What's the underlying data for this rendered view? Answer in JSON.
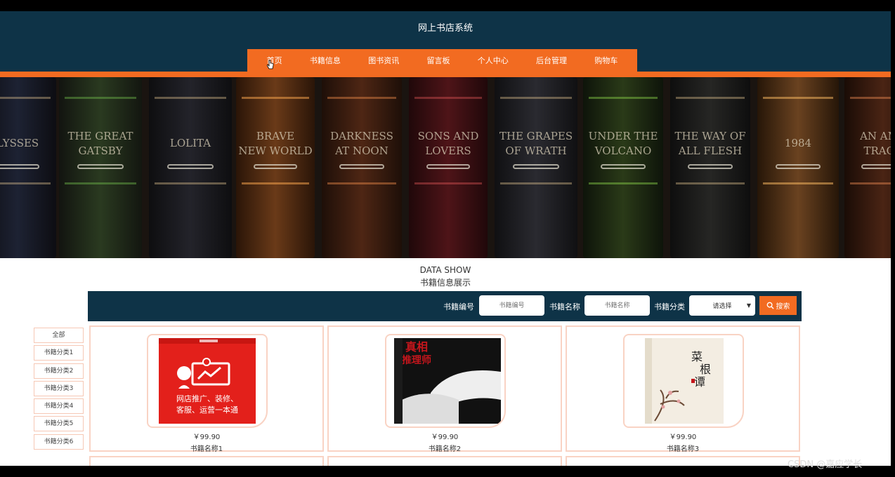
{
  "header": {
    "site_title": "网上书店系统",
    "nav": [
      "首页",
      "书籍信息",
      "图书资讯",
      "留言板",
      "个人中心",
      "后台管理",
      "购物车"
    ]
  },
  "banner": {
    "book_titles": [
      "LYSSES",
      "THE GREAT\nGATSBY",
      "LOLITA",
      "BRAVE\nNEW WORLD",
      "DARKNESS\nAT NOON",
      "SONS AND\nLOVERS",
      "THE GRAPES\nOF WRATH",
      "UNDER THE\nVOLCANO",
      "THE WAY OF\nALL FLESH",
      "1984",
      "AN AME\nTRAGE"
    ],
    "slides": 3,
    "active_slide": 1
  },
  "section": {
    "heading": "DATA SHOW",
    "subheading": "书籍信息展示"
  },
  "search": {
    "label_code": "书籍编号",
    "placeholder_code": "书籍编号",
    "label_name": "书籍名称",
    "placeholder_name": "书籍名称",
    "label_category": "书籍分类",
    "category_selected": "请选择",
    "button": "搜索"
  },
  "categories": [
    "全部",
    "书籍分类1",
    "书籍分类2",
    "书籍分类3",
    "书籍分类4",
    "书籍分类5",
    "书籍分类6"
  ],
  "books": [
    {
      "price": "￥99.90",
      "name": "书籍名称1",
      "cover_text": "网店推广、装修、客服、运营一本通"
    },
    {
      "price": "￥99.90",
      "name": "书籍名称2",
      "cover_text": "真相推理师"
    },
    {
      "price": "￥99.90",
      "name": "书籍名称3",
      "cover_text": "菜根谭"
    }
  ],
  "watermark": "CSDN @嘉应学长"
}
